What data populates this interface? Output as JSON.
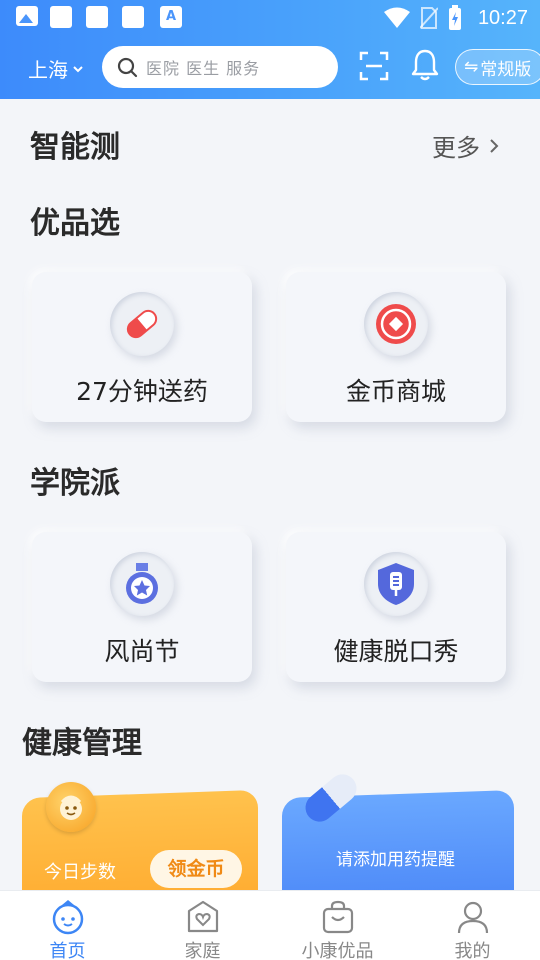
{
  "status_bar": {
    "time": "10:27",
    "input_badge": "A"
  },
  "header": {
    "city": "上海",
    "search_placeholder": "医院 医生 服务",
    "mode_button": "常规版",
    "mode_icon": "⇋"
  },
  "sections": {
    "smart_test": {
      "title": "智能测",
      "more": "更多"
    },
    "premium": {
      "title": "优品选",
      "cards": [
        {
          "label": "27分钟送药"
        },
        {
          "label": "金币商城"
        }
      ]
    },
    "academy": {
      "title": "学院派",
      "cards": [
        {
          "label": "风尚节"
        },
        {
          "label": "健康脱口秀"
        }
      ]
    },
    "health": {
      "title": "健康管理",
      "steps_label": "今日步数",
      "claim_button": "领金币",
      "reminder_label": "请添加用药提醒"
    }
  },
  "tabbar": {
    "items": [
      {
        "label": "首页",
        "icon": "home-face-icon",
        "active": true
      },
      {
        "label": "家庭",
        "icon": "family-heart-icon",
        "active": false
      },
      {
        "label": "小康优品",
        "icon": "shopping-bag-icon",
        "active": false
      },
      {
        "label": "我的",
        "icon": "user-icon",
        "active": false
      }
    ]
  },
  "colors": {
    "brand": "#3d8bfb",
    "active_tab": "#3d86f5",
    "claim_text": "#f08a15"
  }
}
